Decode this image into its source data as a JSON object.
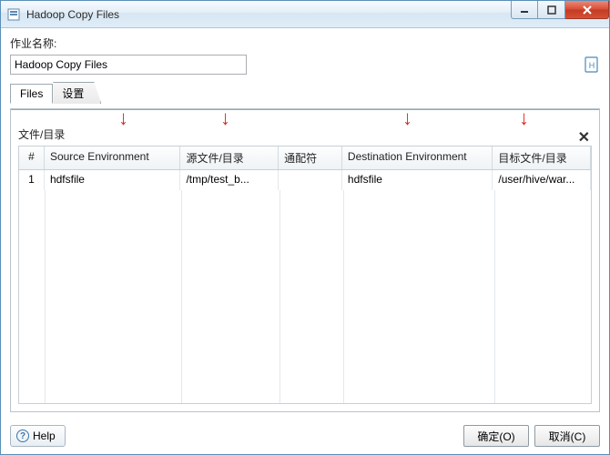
{
  "window": {
    "title": "Hadoop Copy Files"
  },
  "labels": {
    "job_name": "作业名称:",
    "section": "文件/目录"
  },
  "job_name_value": "Hadoop Copy Files",
  "tabs": [
    {
      "label": "Files",
      "active": true
    },
    {
      "label": "设置",
      "active": false
    }
  ],
  "grid": {
    "columns": [
      "#",
      "Source Environment",
      "源文件/目录",
      "通配符",
      "Destination Environment",
      "目标文件/目录"
    ],
    "rows": [
      {
        "idx": "1",
        "src_env": "hdfsfile",
        "src_path": "/tmp/test_b...",
        "glob": "",
        "dst_env": "hdfsfile",
        "dst_path": "/user/hive/war..."
      }
    ]
  },
  "buttons": {
    "help": "Help",
    "ok": "确定(O)",
    "cancel": "取消(C)"
  },
  "icons": {
    "app": "app-icon",
    "doc": "doc-icon",
    "close_panel": "✕"
  }
}
